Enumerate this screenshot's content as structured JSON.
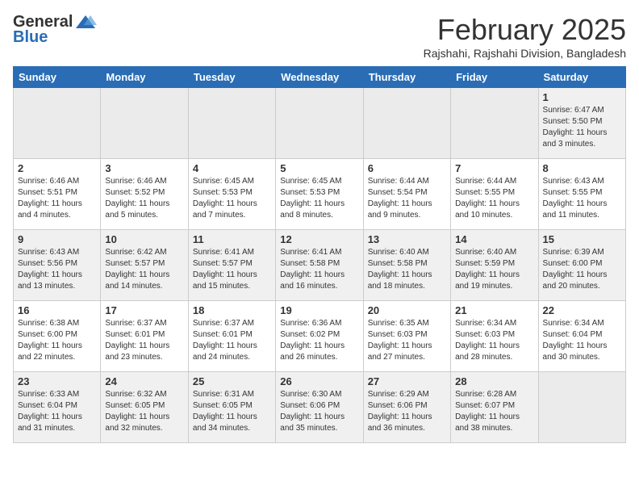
{
  "header": {
    "logo_general": "General",
    "logo_blue": "Blue",
    "month_title": "February 2025",
    "location": "Rajshahi, Rajshahi Division, Bangladesh"
  },
  "weekdays": [
    "Sunday",
    "Monday",
    "Tuesday",
    "Wednesday",
    "Thursday",
    "Friday",
    "Saturday"
  ],
  "weeks": [
    [
      {
        "day": "",
        "info": ""
      },
      {
        "day": "",
        "info": ""
      },
      {
        "day": "",
        "info": ""
      },
      {
        "day": "",
        "info": ""
      },
      {
        "day": "",
        "info": ""
      },
      {
        "day": "",
        "info": ""
      },
      {
        "day": "1",
        "info": "Sunrise: 6:47 AM\nSunset: 5:50 PM\nDaylight: 11 hours and 3 minutes."
      }
    ],
    [
      {
        "day": "2",
        "info": "Sunrise: 6:46 AM\nSunset: 5:51 PM\nDaylight: 11 hours and 4 minutes."
      },
      {
        "day": "3",
        "info": "Sunrise: 6:46 AM\nSunset: 5:52 PM\nDaylight: 11 hours and 5 minutes."
      },
      {
        "day": "4",
        "info": "Sunrise: 6:45 AM\nSunset: 5:53 PM\nDaylight: 11 hours and 7 minutes."
      },
      {
        "day": "5",
        "info": "Sunrise: 6:45 AM\nSunset: 5:53 PM\nDaylight: 11 hours and 8 minutes."
      },
      {
        "day": "6",
        "info": "Sunrise: 6:44 AM\nSunset: 5:54 PM\nDaylight: 11 hours and 9 minutes."
      },
      {
        "day": "7",
        "info": "Sunrise: 6:44 AM\nSunset: 5:55 PM\nDaylight: 11 hours and 10 minutes."
      },
      {
        "day": "8",
        "info": "Sunrise: 6:43 AM\nSunset: 5:55 PM\nDaylight: 11 hours and 11 minutes."
      }
    ],
    [
      {
        "day": "9",
        "info": "Sunrise: 6:43 AM\nSunset: 5:56 PM\nDaylight: 11 hours and 13 minutes."
      },
      {
        "day": "10",
        "info": "Sunrise: 6:42 AM\nSunset: 5:57 PM\nDaylight: 11 hours and 14 minutes."
      },
      {
        "day": "11",
        "info": "Sunrise: 6:41 AM\nSunset: 5:57 PM\nDaylight: 11 hours and 15 minutes."
      },
      {
        "day": "12",
        "info": "Sunrise: 6:41 AM\nSunset: 5:58 PM\nDaylight: 11 hours and 16 minutes."
      },
      {
        "day": "13",
        "info": "Sunrise: 6:40 AM\nSunset: 5:58 PM\nDaylight: 11 hours and 18 minutes."
      },
      {
        "day": "14",
        "info": "Sunrise: 6:40 AM\nSunset: 5:59 PM\nDaylight: 11 hours and 19 minutes."
      },
      {
        "day": "15",
        "info": "Sunrise: 6:39 AM\nSunset: 6:00 PM\nDaylight: 11 hours and 20 minutes."
      }
    ],
    [
      {
        "day": "16",
        "info": "Sunrise: 6:38 AM\nSunset: 6:00 PM\nDaylight: 11 hours and 22 minutes."
      },
      {
        "day": "17",
        "info": "Sunrise: 6:37 AM\nSunset: 6:01 PM\nDaylight: 11 hours and 23 minutes."
      },
      {
        "day": "18",
        "info": "Sunrise: 6:37 AM\nSunset: 6:01 PM\nDaylight: 11 hours and 24 minutes."
      },
      {
        "day": "19",
        "info": "Sunrise: 6:36 AM\nSunset: 6:02 PM\nDaylight: 11 hours and 26 minutes."
      },
      {
        "day": "20",
        "info": "Sunrise: 6:35 AM\nSunset: 6:03 PM\nDaylight: 11 hours and 27 minutes."
      },
      {
        "day": "21",
        "info": "Sunrise: 6:34 AM\nSunset: 6:03 PM\nDaylight: 11 hours and 28 minutes."
      },
      {
        "day": "22",
        "info": "Sunrise: 6:34 AM\nSunset: 6:04 PM\nDaylight: 11 hours and 30 minutes."
      }
    ],
    [
      {
        "day": "23",
        "info": "Sunrise: 6:33 AM\nSunset: 6:04 PM\nDaylight: 11 hours and 31 minutes."
      },
      {
        "day": "24",
        "info": "Sunrise: 6:32 AM\nSunset: 6:05 PM\nDaylight: 11 hours and 32 minutes."
      },
      {
        "day": "25",
        "info": "Sunrise: 6:31 AM\nSunset: 6:05 PM\nDaylight: 11 hours and 34 minutes."
      },
      {
        "day": "26",
        "info": "Sunrise: 6:30 AM\nSunset: 6:06 PM\nDaylight: 11 hours and 35 minutes."
      },
      {
        "day": "27",
        "info": "Sunrise: 6:29 AM\nSunset: 6:06 PM\nDaylight: 11 hours and 36 minutes."
      },
      {
        "day": "28",
        "info": "Sunrise: 6:28 AM\nSunset: 6:07 PM\nDaylight: 11 hours and 38 minutes."
      },
      {
        "day": "",
        "info": ""
      }
    ]
  ]
}
